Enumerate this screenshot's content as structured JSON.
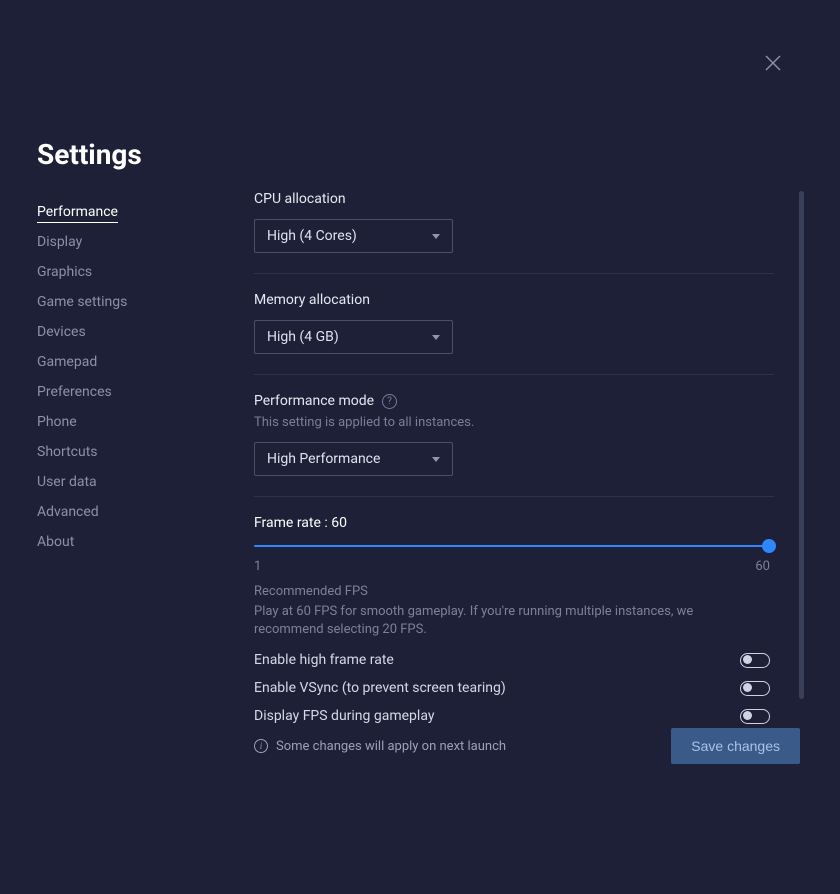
{
  "title": "Settings",
  "sidebar": {
    "items": [
      {
        "label": "Performance",
        "active": true
      },
      {
        "label": "Display"
      },
      {
        "label": "Graphics"
      },
      {
        "label": "Game settings"
      },
      {
        "label": "Devices"
      },
      {
        "label": "Gamepad"
      },
      {
        "label": "Preferences"
      },
      {
        "label": "Phone"
      },
      {
        "label": "Shortcuts"
      },
      {
        "label": "User data"
      },
      {
        "label": "Advanced"
      },
      {
        "label": "About"
      }
    ]
  },
  "cpu": {
    "label": "CPU allocation",
    "value": "High (4 Cores)"
  },
  "mem": {
    "label": "Memory allocation",
    "value": "High (4 GB)"
  },
  "perf": {
    "label": "Performance mode",
    "sub": "This setting is applied to all instances.",
    "value": "High Performance"
  },
  "frame": {
    "label": "Frame rate : 60",
    "min": "1",
    "max": "60",
    "value": 60,
    "rec_title": "Recommended FPS",
    "rec_body": "Play at 60 FPS for smooth gameplay. If you're running multiple instances, we recommend selecting 20 FPS."
  },
  "toggles": {
    "hifr": "Enable high frame rate",
    "vsync": "Enable VSync (to prevent screen tearing)",
    "fps": "Display FPS during gameplay"
  },
  "footer": {
    "note": "Some changes will apply on next launch",
    "save": "Save changes"
  }
}
